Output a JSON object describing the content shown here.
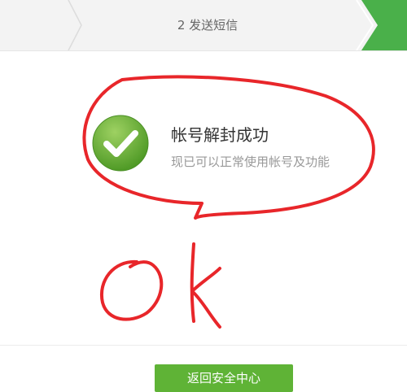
{
  "progress": {
    "step_label": "2 发送短信"
  },
  "result": {
    "title": "帐号解封成功",
    "description": "现已可以正常使用帐号及功能",
    "icon": "check-circle-icon"
  },
  "annotation": {
    "text": "OK",
    "color": "#e8262a"
  },
  "actions": {
    "return_label": "返回安全中心"
  },
  "colors": {
    "accent": "#5fb336",
    "check_icon": "#6ab23c"
  }
}
